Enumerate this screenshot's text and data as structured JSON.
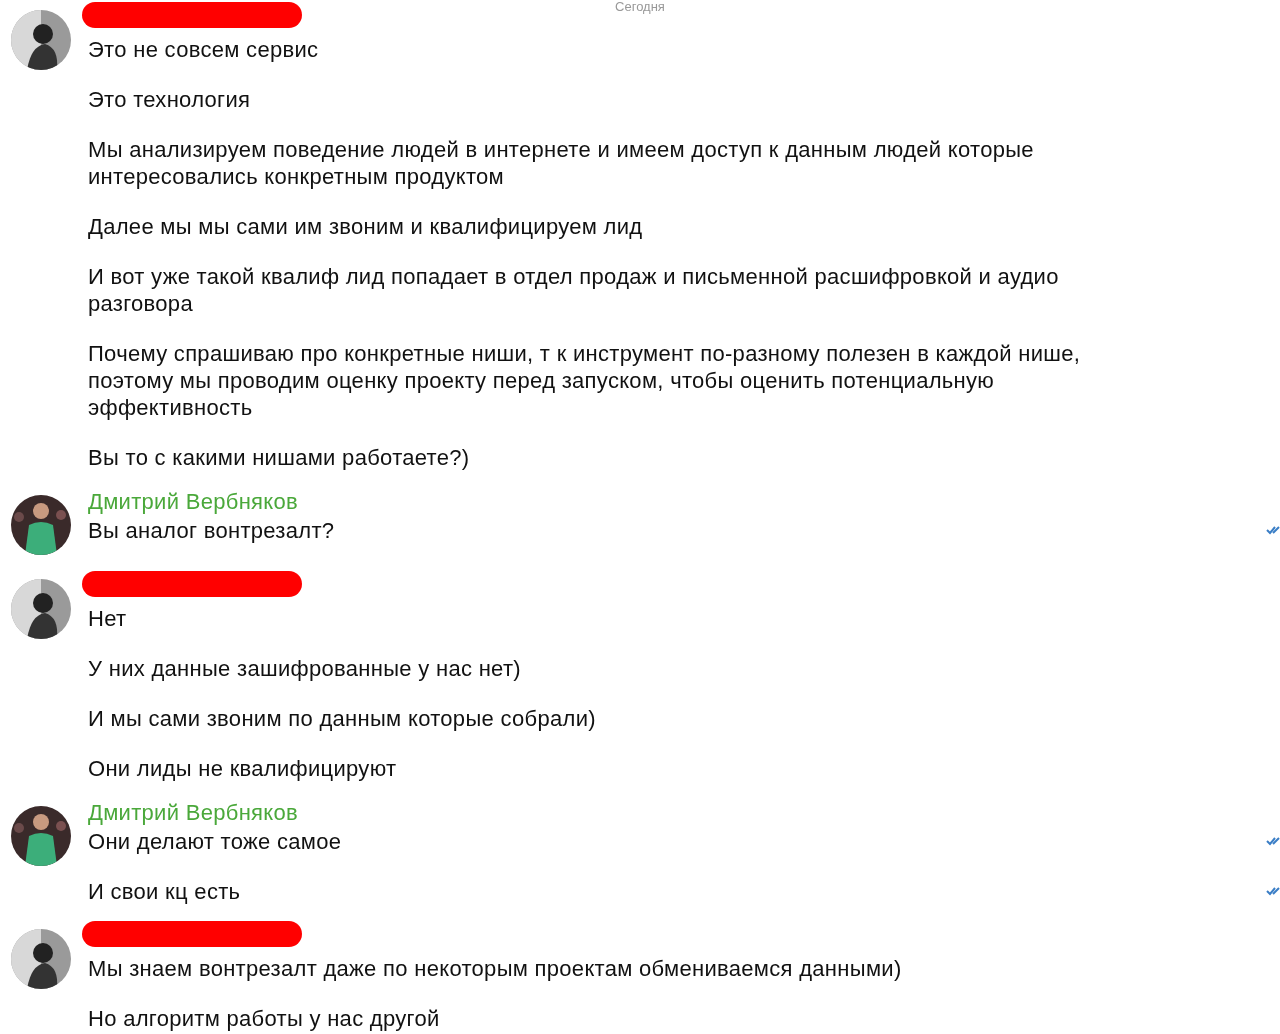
{
  "date_divider": "Сегодня",
  "groups": [
    {
      "redacted": true,
      "messages": [
        {
          "text": "Это не совсем сервис",
          "read": false
        },
        {
          "text": "Это технология",
          "read": false
        },
        {
          "text": "Мы анализируем поведение людей в интернете и имеем доступ к данным людей которые интересовались конкретным продуктом",
          "read": false
        },
        {
          "text": "Далее мы мы сами им звоним и квалифицируем лид",
          "read": false
        },
        {
          "text": "И вот уже такой квалиф лид попадает в отдел продаж и письменной расшифровкой и аудио разговора",
          "read": false
        },
        {
          "text": "Почему спрашиваю про конкретные ниши, т к инструмент   по-разному полезен в каждой нише, поэтому мы проводим оценку проекту перед запуском, чтобы оценить потенциальную эффективность",
          "read": false
        },
        {
          "text": "Вы то с какими нишами работаете?)",
          "read": false
        }
      ]
    },
    {
      "redacted": false,
      "name": "Дмитрий Вербняков",
      "color": "#4aa83a",
      "messages": [
        {
          "text": "Вы аналог вонтрезалт?",
          "read": true
        }
      ]
    },
    {
      "redacted": true,
      "messages": [
        {
          "text": "Нет",
          "read": false
        },
        {
          "text": "У них данные зашифрованные у нас нет)",
          "read": false
        },
        {
          "text": "И мы сами звоним по данным которые собрали)",
          "read": false
        },
        {
          "text": "Они лиды не квалифицируют",
          "read": false
        }
      ]
    },
    {
      "redacted": false,
      "name": "Дмитрий Вербняков",
      "color": "#4aa83a",
      "messages": [
        {
          "text": "Они делают тоже самое",
          "read": true
        },
        {
          "text": "И свои кц есть",
          "read": true
        }
      ]
    },
    {
      "redacted": true,
      "messages": [
        {
          "text": "Мы знаем вонтрезалт даже по некоторым проектам обмениваемся данными)",
          "read": false
        },
        {
          "text": "Но алгоритм работы у нас другой",
          "read": false
        }
      ]
    }
  ]
}
